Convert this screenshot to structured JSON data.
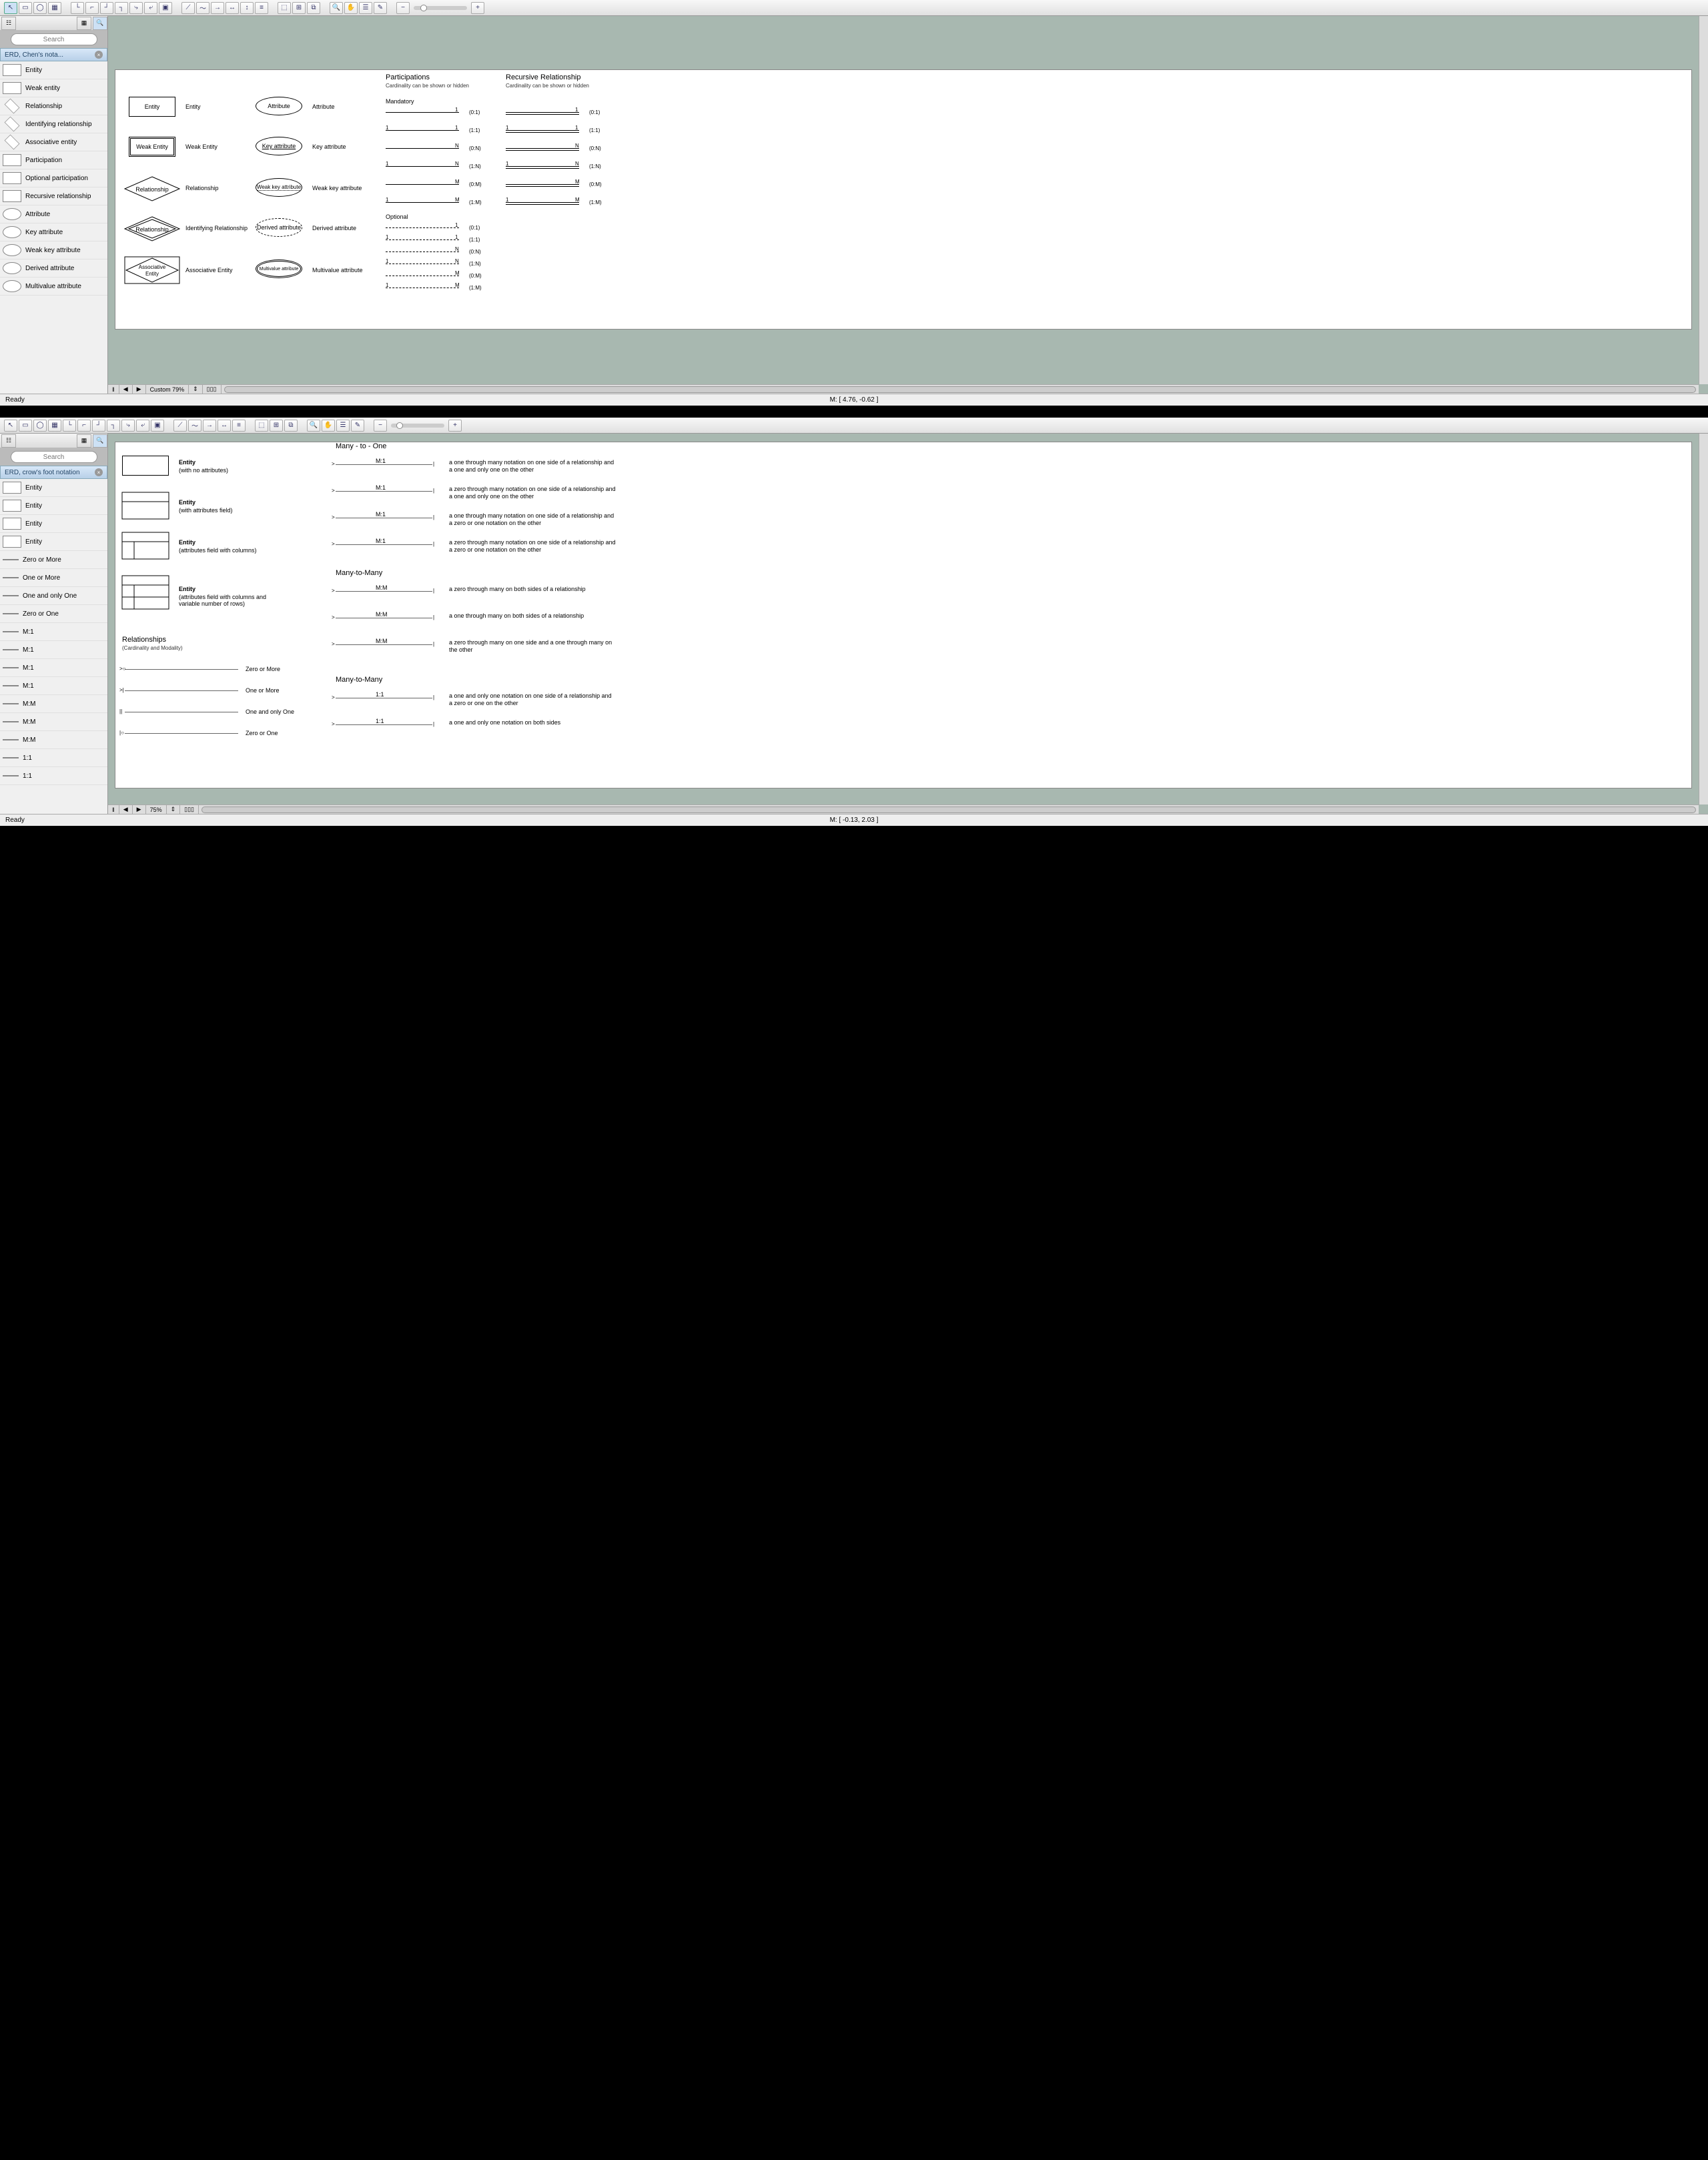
{
  "app1": {
    "toolbar_icons": [
      "arrow",
      "rect",
      "ellipse",
      "grid",
      "conn1",
      "conn2",
      "conn3",
      "conn4",
      "conn5",
      "conn6",
      "snap",
      "line1",
      "line2",
      "line3",
      "line4",
      "line5",
      "line6",
      "group1",
      "group2",
      "group3",
      "zoom-out",
      "pan",
      "layers",
      "ruler",
      "zoom-minus",
      "zoom-plus"
    ],
    "search_placeholder": "Search",
    "section_title": "ERD, Chen's nota...",
    "palette": [
      "Entity",
      "Weak entity",
      "Relationship",
      "Identifying relationship",
      "Associative entity",
      "Participation",
      "Optional participation",
      "Recursive relationship",
      "Attribute",
      "Key attribute",
      "Weak key attribute",
      "Derived attribute",
      "Multivalue attribute"
    ],
    "canvas": {
      "left_col": [
        {
          "shape": "Entity",
          "label": "Entity"
        },
        {
          "shape": "Weak Entity",
          "label": "Weak Entity"
        },
        {
          "shape": "Relationship",
          "label": "Relationship"
        },
        {
          "shape": "Relationship",
          "label": "Identifying Relationship"
        },
        {
          "shape": "Associative Entity",
          "label": "Associative Entity"
        }
      ],
      "mid_col": [
        {
          "shape": "Attribute",
          "label": "Attribute"
        },
        {
          "shape": "Key attribute",
          "label": "Key attribute"
        },
        {
          "shape": "Weak key attribute",
          "label": "Weak key attribute"
        },
        {
          "shape": "Derived attribute",
          "label": "Derived attribute"
        },
        {
          "shape": "Multivalue attribute",
          "label": "Multivalue attribute"
        }
      ],
      "participations_title": "Participations",
      "participations_sub": "Cardinality can be shown or hidden",
      "mandatory_title": "Mandatory",
      "optional_title": "Optional",
      "recursive_title": "Recursive Relationship",
      "recursive_sub": "Cardinality can be shown or hidden",
      "mandatory_cards": [
        {
          "l": "",
          "r": "1",
          "t": "(0:1)"
        },
        {
          "l": "1",
          "r": "1",
          "t": "(1:1)"
        },
        {
          "l": "",
          "r": "N",
          "t": "(0:N)"
        },
        {
          "l": "1",
          "r": "N",
          "t": "(1:N)"
        },
        {
          "l": "",
          "r": "M",
          "t": "(0:M)"
        },
        {
          "l": "1",
          "r": "M",
          "t": "(1:M)"
        }
      ],
      "optional_cards": [
        {
          "l": "",
          "r": "1",
          "t": "(0:1)"
        },
        {
          "l": "1",
          "r": "1",
          "t": "(1:1)"
        },
        {
          "l": "",
          "r": "N",
          "t": "(0:N)"
        },
        {
          "l": "1",
          "r": "N",
          "t": "(1:N)"
        },
        {
          "l": "",
          "r": "M",
          "t": "(0:M)"
        },
        {
          "l": "1",
          "r": "M",
          "t": "(1:M)"
        }
      ],
      "recursive_cards": [
        {
          "l": "",
          "r": "1",
          "t": "(0:1)"
        },
        {
          "l": "1",
          "r": "1",
          "t": "(1:1)"
        },
        {
          "l": "",
          "r": "N",
          "t": "(0:N)"
        },
        {
          "l": "1",
          "r": "N",
          "t": "(1:N)"
        },
        {
          "l": "",
          "r": "M",
          "t": "(0:M)"
        },
        {
          "l": "1",
          "r": "M",
          "t": "(1:M)"
        }
      ]
    },
    "zoom_label": "Custom 79%",
    "status": "Ready",
    "mouse": "M: [ 4.76, -0.62 ]"
  },
  "app2": {
    "search_placeholder": "Search",
    "section_title": "ERD, crow's foot notation",
    "palette": [
      "Entity",
      "Entity",
      "Entity",
      "Entity",
      "Zero or More",
      "One or More",
      "One and only One",
      "Zero or One",
      "M:1",
      "M:1",
      "M:1",
      "M:1",
      "M:M",
      "M:M",
      "M:M",
      "1:1",
      "1:1"
    ],
    "canvas": {
      "entities": [
        {
          "title": "Entity",
          "sub": "(with no attributes)"
        },
        {
          "title": "Entity",
          "sub": "(with attributes field)"
        },
        {
          "title": "Entity",
          "sub": "(attributes field with columns)"
        },
        {
          "title": "Entity",
          "sub": "(attributes field with columns and variable number of rows)"
        }
      ],
      "rel_title": "Relationships",
      "rel_sub": "(Cardinality and Modality)",
      "rel_items": [
        "Zero or More",
        "One or More",
        "One and only One",
        "Zero or One"
      ],
      "m1_title": "Many - to - One",
      "m1_items": [
        {
          "c": "M:1",
          "d": "a one through many notation on one side of a relationship and a one and only one on the other"
        },
        {
          "c": "M:1",
          "d": "a zero through many notation on one side of a relationship and a one and only one on the other"
        },
        {
          "c": "M:1",
          "d": "a one through many notation on one side of a relationship and a zero or one notation on the other"
        },
        {
          "c": "M:1",
          "d": "a zero through many notation on one side of a relationship and a zero or one notation on the other"
        }
      ],
      "mm_title": "Many-to-Many",
      "mm_items": [
        {
          "c": "M:M",
          "d": "a zero through many on both sides of a relationship"
        },
        {
          "c": "M:M",
          "d": "a one through many on both sides of a relationship"
        },
        {
          "c": "M:M",
          "d": "a zero through many on one side and a one through many on the other"
        }
      ],
      "oo_title": "Many-to-Many",
      "oo_items": [
        {
          "c": "1:1",
          "d": "a one and only one notation on one side of a relationship and a zero or one on the other"
        },
        {
          "c": "1:1",
          "d": "a one and only one notation on both sides"
        }
      ]
    },
    "zoom_label": "75%",
    "status": "Ready",
    "mouse": "M: [ -0.13, 2.03 ]"
  }
}
